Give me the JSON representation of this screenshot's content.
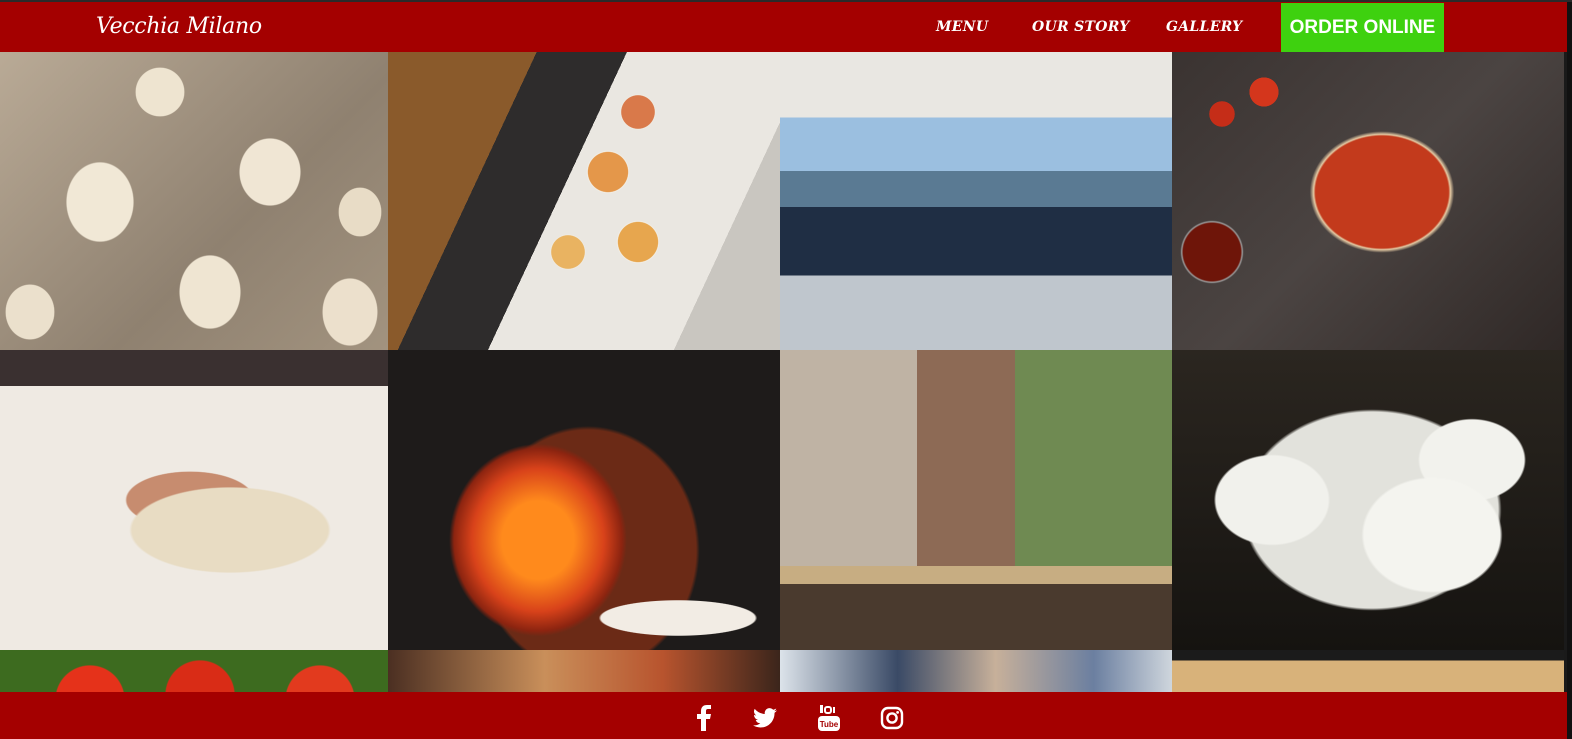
{
  "brand": {
    "name": "Vecchia Milano"
  },
  "nav": {
    "items": [
      {
        "label": "MENU"
      },
      {
        "label": "OUR STORY"
      },
      {
        "label": "GALLERY"
      }
    ],
    "order_button": "ORDER ONLINE"
  },
  "gallery": {
    "tiles": [
      "dough-balls-photo",
      "pizza-kitchen-photo",
      "terrace-dining-photo",
      "tomato-sauce-pizza-photo",
      "kneading-dough-photo",
      "wood-fired-oven-photo",
      "friends-dining-photo",
      "mozzarella-photo",
      "tomatoes-photo",
      "pizza-photo",
      "crowd-photo",
      "pizza-close-up-photo"
    ]
  },
  "footer": {
    "social": [
      "facebook-icon",
      "twitter-icon",
      "youtube-icon",
      "instagram-icon"
    ]
  },
  "colors": {
    "header_bg": "#a40000",
    "order_button_bg": "#3ed10f",
    "text": "#ffffff"
  }
}
